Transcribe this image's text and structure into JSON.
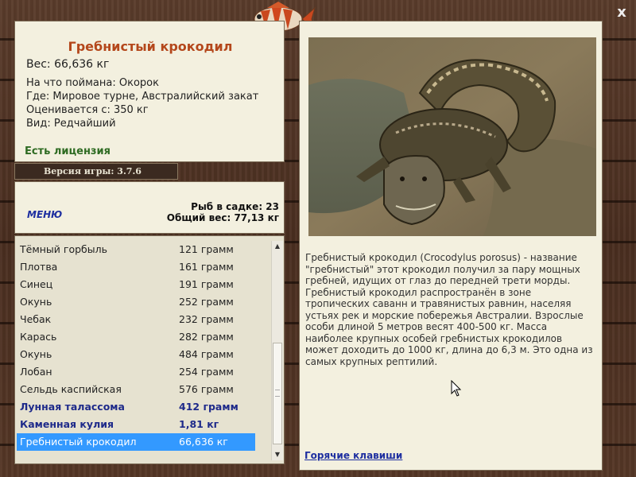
{
  "fish_info": {
    "title": "Гребнистый крокодил",
    "weight": "Вес: 66,636 кг",
    "bait": "На что поймана: Окорок",
    "location": "Где: Мировое турне, Австралийский закат",
    "valuation": "Оценивается с: 350 кг",
    "rarity": "Вид: Редчайший",
    "license": "Есть лицензия"
  },
  "version": "Версия игры: 3.7.6",
  "menu_label": "МЕНЮ",
  "cage": {
    "fish_count": "Рыб в садке: 23",
    "total_weight": "Общий вес: 77,13 кг"
  },
  "catch_list": [
    {
      "name": "Тёмный горбыль",
      "weight": "121 грамм",
      "bold": false,
      "selected": false
    },
    {
      "name": "Плотва",
      "weight": "161 грамм",
      "bold": false,
      "selected": false
    },
    {
      "name": "Синец",
      "weight": "191 грамм",
      "bold": false,
      "selected": false
    },
    {
      "name": "Окунь",
      "weight": "252 грамм",
      "bold": false,
      "selected": false
    },
    {
      "name": "Чебак",
      "weight": "232 грамм",
      "bold": false,
      "selected": false
    },
    {
      "name": "Карась",
      "weight": "282 грамм",
      "bold": false,
      "selected": false
    },
    {
      "name": "Окунь",
      "weight": "484 грамм",
      "bold": false,
      "selected": false
    },
    {
      "name": "Лобан",
      "weight": "254 грамм",
      "bold": false,
      "selected": false
    },
    {
      "name": "Сельдь каспийская",
      "weight": "576 грамм",
      "bold": false,
      "selected": false
    },
    {
      "name": "Лунная талассома",
      "weight": "412 грамм",
      "bold": true,
      "selected": false
    },
    {
      "name": "Каменная кулия",
      "weight": "1,81 кг",
      "bold": true,
      "selected": false
    },
    {
      "name": "Гребнистый крокодил",
      "weight": "66,636 кг",
      "bold": false,
      "selected": true
    }
  ],
  "description": "Гребнистый крокодил (Crocodylus porosus) - название \"гребнистый\" этот крокодил получил за пару мощных гребней, идущих от глаз до передней трети морды. Гребнистый крокодил распространён в зоне тропических саванн и травянистых равнин, населяя устьях рек и морские побережья Австралии. Взрослые особи длиной 5 метров весят 400-500 кг. Масса наиболее крупных особей гребнистых крокодилов может доходить до 1000 кг, длина до 6,3 м. Это одна из самых крупных рептилий.",
  "hotkeys_label": "Горячие клавиши",
  "close_label": "x"
}
